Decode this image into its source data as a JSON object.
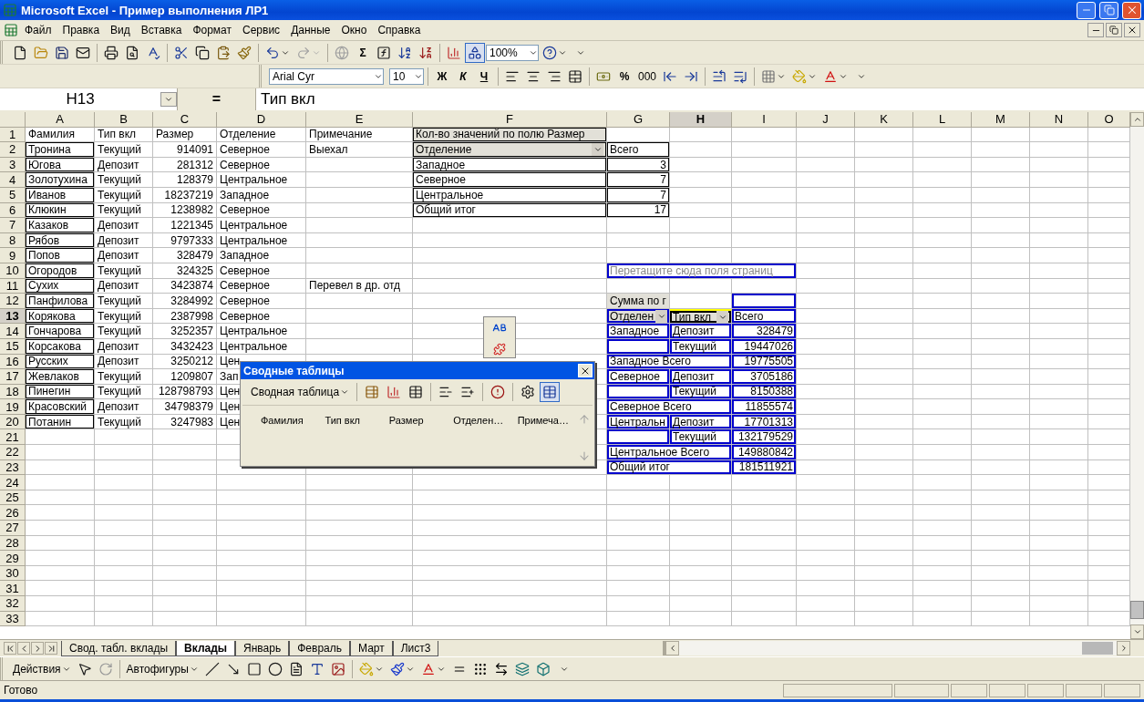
{
  "window": {
    "title": "Microsoft Excel - Пример выполнения ЛР1"
  },
  "menu": [
    "Файл",
    "Правка",
    "Вид",
    "Вставка",
    "Формат",
    "Сервис",
    "Данные",
    "Окно",
    "Справка"
  ],
  "standard_toolbar": {
    "sum": "Σ",
    "zoom": "100%",
    "redo": {
      "disabled": true
    },
    "hyperlink": {
      "disabled": true
    }
  },
  "formatting_toolbar": {
    "font": "Arial Cyr",
    "size": "10",
    "bold": "Ж",
    "italic": "К",
    "underline": "Ч",
    "percent": "%",
    "thousands": "000"
  },
  "formula_bar": {
    "name_box": "H13",
    "equals": "=",
    "value": "Тип вкл"
  },
  "columns": [
    {
      "label": "A",
      "selected": false
    },
    {
      "label": "B",
      "selected": false
    },
    {
      "label": "C",
      "selected": false
    },
    {
      "label": "D",
      "selected": false
    },
    {
      "label": "E",
      "selected": false
    },
    {
      "label": "F",
      "selected": false
    },
    {
      "label": "G",
      "selected": false
    },
    {
      "label": "H",
      "selected": true
    },
    {
      "label": "I",
      "selected": false
    },
    {
      "label": "J",
      "selected": false
    },
    {
      "label": "K",
      "selected": false
    },
    {
      "label": "L",
      "selected": false
    },
    {
      "label": "M",
      "selected": false
    },
    {
      "label": "N",
      "selected": false
    },
    {
      "label": "O",
      "selected": false
    }
  ],
  "rows": [
    {
      "label": "1",
      "selected": false,
      "cells": [
        {
          "kind": "text",
          "text": "Фамилия"
        },
        {
          "kind": "text",
          "text": "Тип вкл"
        },
        {
          "kind": "text",
          "text": "Размер"
        },
        {
          "kind": "text",
          "text": "Отделение"
        },
        {
          "kind": "text",
          "text": "Примечание"
        },
        {
          "kind": "pt-caption",
          "text": "Кол-во значений по полю Размер"
        }
      ]
    },
    {
      "label": "2",
      "selected": false,
      "cells": [
        {
          "kind": "boxed",
          "text": "Тронина"
        },
        {
          "kind": "text",
          "text": "Текущий"
        },
        {
          "kind": "num",
          "text": "914091"
        },
        {
          "kind": "text",
          "text": "Северное"
        },
        {
          "kind": "text",
          "text": "Выехал"
        },
        {
          "kind": "pt-field",
          "text": "Отделение"
        },
        {
          "kind": "pt",
          "text": "Всего"
        }
      ]
    },
    {
      "label": "3",
      "selected": false,
      "cells": [
        {
          "kind": "boxed",
          "text": "Югова"
        },
        {
          "kind": "text",
          "text": "Депозит"
        },
        {
          "kind": "num",
          "text": "281312"
        },
        {
          "kind": "text",
          "text": "Северное"
        },
        {
          "kind": "empty"
        },
        {
          "kind": "pt",
          "text": "Западное"
        },
        {
          "kind": "pt-num",
          "text": "3"
        }
      ]
    },
    {
      "label": "4",
      "selected": false,
      "cells": [
        {
          "kind": "boxed",
          "text": "Золотухина"
        },
        {
          "kind": "text",
          "text": "Текущий"
        },
        {
          "kind": "num",
          "text": "128379"
        },
        {
          "kind": "text",
          "text": "Центральное"
        },
        {
          "kind": "empty"
        },
        {
          "kind": "pt",
          "text": "Северное"
        },
        {
          "kind": "pt-num",
          "text": "7"
        }
      ]
    },
    {
      "label": "5",
      "selected": false,
      "cells": [
        {
          "kind": "boxed",
          "text": "Иванов"
        },
        {
          "kind": "text",
          "text": "Текущий"
        },
        {
          "kind": "num",
          "text": "18237219"
        },
        {
          "kind": "text",
          "text": "Западное"
        },
        {
          "kind": "empty"
        },
        {
          "kind": "pt",
          "text": "Центральное"
        },
        {
          "kind": "pt-num",
          "text": "7"
        }
      ]
    },
    {
      "label": "6",
      "selected": false,
      "cells": [
        {
          "kind": "boxed",
          "text": "Клюкин"
        },
        {
          "kind": "text",
          "text": "Текущий"
        },
        {
          "kind": "num",
          "text": "1238982"
        },
        {
          "kind": "text",
          "text": "Северное"
        },
        {
          "kind": "empty"
        },
        {
          "kind": "pt",
          "text": "Общий итог"
        },
        {
          "kind": "pt-num",
          "text": "17"
        }
      ]
    },
    {
      "label": "7",
      "selected": false,
      "cells": [
        {
          "kind": "boxed",
          "text": "Казаков"
        },
        {
          "kind": "text",
          "text": "Депозит"
        },
        {
          "kind": "num",
          "text": "1221345"
        },
        {
          "kind": "text",
          "text": "Центральное"
        }
      ]
    },
    {
      "label": "8",
      "selected": false,
      "cells": [
        {
          "kind": "boxed",
          "text": "Рябов"
        },
        {
          "kind": "text",
          "text": "Депозит"
        },
        {
          "kind": "num",
          "text": "9797333"
        },
        {
          "kind": "text",
          "text": "Центральное"
        }
      ]
    },
    {
      "label": "9",
      "selected": false,
      "cells": [
        {
          "kind": "boxed",
          "text": "Попов"
        },
        {
          "kind": "text",
          "text": "Депозит"
        },
        {
          "kind": "num",
          "text": "328479"
        },
        {
          "kind": "text",
          "text": "Западное"
        }
      ]
    },
    {
      "label": "10",
      "selected": false,
      "cells": [
        {
          "kind": "boxed",
          "text": "Огородов"
        },
        {
          "kind": "text",
          "text": "Текущий"
        },
        {
          "kind": "num",
          "text": "324325"
        },
        {
          "kind": "text",
          "text": "Северное"
        },
        {
          "kind": "empty"
        },
        {
          "kind": "empty"
        },
        {
          "kind": "bt-hint",
          "text": "Перетащите сюда поля страниц"
        }
      ]
    },
    {
      "label": "11",
      "selected": false,
      "cells": [
        {
          "kind": "boxed",
          "text": "Сухих"
        },
        {
          "kind": "text",
          "text": "Депозит"
        },
        {
          "kind": "num",
          "text": "3423874"
        },
        {
          "kind": "text",
          "text": "Северное"
        },
        {
          "kind": "text",
          "text": "Перевел в др. отд"
        }
      ]
    },
    {
      "label": "12",
      "selected": false,
      "cells": [
        {
          "kind": "boxed",
          "text": "Панфилова"
        },
        {
          "kind": "text",
          "text": "Текущий"
        },
        {
          "kind": "num",
          "text": "3284992"
        },
        {
          "kind": "text",
          "text": "Северное"
        },
        {
          "kind": "empty"
        },
        {
          "kind": "empty"
        },
        {
          "kind": "bt-caption",
          "text": "Сумма по г"
        },
        {
          "kind": "empty"
        },
        {
          "kind": "bt-frame"
        }
      ]
    },
    {
      "label": "13",
      "selected": true,
      "cells": [
        {
          "kind": "boxed",
          "text": "Корякова"
        },
        {
          "kind": "text",
          "text": "Текущий"
        },
        {
          "kind": "num",
          "text": "2387998"
        },
        {
          "kind": "text",
          "text": "Северное"
        },
        {
          "kind": "empty"
        },
        {
          "kind": "empty"
        },
        {
          "kind": "bt-field",
          "text": "Отделен"
        },
        {
          "kind": "bt-field",
          "text": "Тип вкл"
        },
        {
          "kind": "bt",
          "text": "Всего"
        }
      ]
    },
    {
      "label": "14",
      "selected": false,
      "cells": [
        {
          "kind": "boxed",
          "text": "Гончарова"
        },
        {
          "kind": "text",
          "text": "Текущий"
        },
        {
          "kind": "num",
          "text": "3252357"
        },
        {
          "kind": "text",
          "text": "Центральное"
        },
        {
          "kind": "empty"
        },
        {
          "kind": "empty"
        },
        {
          "kind": "bt",
          "text": "Западное"
        },
        {
          "kind": "bt",
          "text": "Депозит"
        },
        {
          "kind": "bt-num",
          "text": "328479"
        }
      ]
    },
    {
      "label": "15",
      "selected": false,
      "cells": [
        {
          "kind": "boxed",
          "text": "Корсакова"
        },
        {
          "kind": "text",
          "text": "Депозит"
        },
        {
          "kind": "num",
          "text": "3432423"
        },
        {
          "kind": "text",
          "text": "Центральное"
        },
        {
          "kind": "empty"
        },
        {
          "kind": "empty"
        },
        {
          "kind": "bt-frame"
        },
        {
          "kind": "bt",
          "text": "Текущий"
        },
        {
          "kind": "bt-num",
          "text": "19447026"
        }
      ]
    },
    {
      "label": "16",
      "selected": false,
      "cells": [
        {
          "kind": "boxed",
          "text": "Русских"
        },
        {
          "kind": "text",
          "text": "Депозит"
        },
        {
          "kind": "num",
          "text": "3250212"
        },
        {
          "kind": "text",
          "text": "Цен"
        },
        {
          "kind": "empty"
        },
        {
          "kind": "empty"
        },
        {
          "kind": "bt-total",
          "text": "Западное Всего"
        },
        {
          "kind": "bt-num",
          "text": "19775505"
        }
      ]
    },
    {
      "label": "17",
      "selected": false,
      "cells": [
        {
          "kind": "boxed",
          "text": "Жевлаков"
        },
        {
          "kind": "text",
          "text": "Текущий"
        },
        {
          "kind": "num",
          "text": "1209807"
        },
        {
          "kind": "text",
          "text": "Зап"
        },
        {
          "kind": "hidden"
        },
        {
          "kind": "empty"
        },
        {
          "kind": "bt",
          "text": "Северное"
        },
        {
          "kind": "bt",
          "text": "Депозит"
        },
        {
          "kind": "bt-num",
          "text": "3705186"
        }
      ]
    },
    {
      "label": "18",
      "selected": false,
      "cells": [
        {
          "kind": "boxed",
          "text": "Пинегин"
        },
        {
          "kind": "text",
          "text": "Текущий"
        },
        {
          "kind": "num",
          "text": "128798793"
        },
        {
          "kind": "text",
          "text": "Цен"
        },
        {
          "kind": "hidden"
        },
        {
          "kind": "empty"
        },
        {
          "kind": "bt-frame"
        },
        {
          "kind": "bt",
          "text": "Текущий"
        },
        {
          "kind": "bt-num",
          "text": "8150388"
        }
      ]
    },
    {
      "label": "19",
      "selected": false,
      "cells": [
        {
          "kind": "boxed",
          "text": "Красовский"
        },
        {
          "kind": "text",
          "text": "Депозит"
        },
        {
          "kind": "num",
          "text": "34798379"
        },
        {
          "kind": "text",
          "text": "Цен"
        },
        {
          "kind": "hidden"
        },
        {
          "kind": "empty"
        },
        {
          "kind": "bt-total",
          "text": "Северное Всего"
        },
        {
          "kind": "bt-num",
          "text": "11855574"
        }
      ]
    },
    {
      "label": "20",
      "selected": false,
      "cells": [
        {
          "kind": "boxed",
          "text": "Потанин"
        },
        {
          "kind": "text",
          "text": "Текущий"
        },
        {
          "kind": "num",
          "text": "3247983"
        },
        {
          "kind": "text",
          "text": "Цен"
        },
        {
          "kind": "hidden"
        },
        {
          "kind": "empty"
        },
        {
          "kind": "bt",
          "text": "Центральн"
        },
        {
          "kind": "bt",
          "text": "Депозит"
        },
        {
          "kind": "bt-num",
          "text": "17701313"
        }
      ]
    },
    {
      "label": "21",
      "selected": false,
      "cells": [
        {
          "kind": "empty"
        },
        {
          "kind": "empty"
        },
        {
          "kind": "empty"
        },
        {
          "kind": "empty"
        },
        {
          "kind": "empty"
        },
        {
          "kind": "empty"
        },
        {
          "kind": "bt-frame"
        },
        {
          "kind": "bt",
          "text": "Текущий"
        },
        {
          "kind": "bt-num",
          "text": "132179529"
        }
      ]
    },
    {
      "label": "22",
      "selected": false,
      "cells": [
        {
          "kind": "empty"
        },
        {
          "kind": "empty"
        },
        {
          "kind": "empty"
        },
        {
          "kind": "empty"
        },
        {
          "kind": "empty"
        },
        {
          "kind": "empty"
        },
        {
          "kind": "bt-total",
          "text": "Центральное Всего"
        },
        {
          "kind": "bt-num",
          "text": "149880842"
        }
      ]
    },
    {
      "label": "23",
      "selected": false,
      "cells": [
        {
          "kind": "empty"
        },
        {
          "kind": "empty"
        },
        {
          "kind": "empty"
        },
        {
          "kind": "empty"
        },
        {
          "kind": "empty"
        },
        {
          "kind": "empty"
        },
        {
          "kind": "bt-total",
          "text": "Общий итог"
        },
        {
          "kind": "bt-num",
          "text": "181511921"
        }
      ]
    },
    {
      "label": "24",
      "selected": false
    },
    {
      "label": "25",
      "selected": false
    },
    {
      "label": "26",
      "selected": false
    },
    {
      "label": "27",
      "selected": false
    },
    {
      "label": "28",
      "selected": false
    },
    {
      "label": "29",
      "selected": false
    },
    {
      "label": "30",
      "selected": false
    },
    {
      "label": "31",
      "selected": false
    },
    {
      "label": "32",
      "selected": false
    },
    {
      "label": "33",
      "selected": false
    }
  ],
  "pivot_toolbar": {
    "title": "Сводные таблицы",
    "menu": "Сводная таблица",
    "fields": [
      "Фамилия",
      "Тип вкл",
      "Размер",
      "Отделен…",
      "Примеча…"
    ]
  },
  "sheet_tabs": [
    {
      "label": "Свод. табл. вклады",
      "selected": false
    },
    {
      "label": "Вклады",
      "selected": true
    },
    {
      "label": "Январь",
      "selected": false
    },
    {
      "label": "Февраль",
      "selected": false
    },
    {
      "label": "Март",
      "selected": false
    },
    {
      "label": "Лист3",
      "selected": false
    }
  ],
  "drawing_toolbar": {
    "actions": "Действия",
    "autoshapes": "Автофигуры"
  },
  "status_bar": {
    "text": "Готово"
  }
}
